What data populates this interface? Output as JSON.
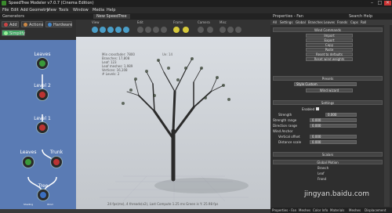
{
  "window": {
    "title": "SpeedTree Modeler v7.0.7 (Cinema Edition)",
    "controls": [
      "–",
      "□",
      "✕"
    ]
  },
  "menu": [
    "File",
    "Edit",
    "Add Geometry",
    "View",
    "Tools",
    "Window",
    "Media",
    "Help"
  ],
  "left_panel": {
    "title": "Generators",
    "buttons": {
      "add": "Add",
      "actions": "Actions",
      "hardware": "Hardware",
      "simplify": "Simplify"
    },
    "nodes": {
      "leaves_top": "Leaves",
      "level2": "Level 2",
      "level1": "Level 1",
      "leaves_left": "Leaves",
      "trunk": "Trunk",
      "tree": "Tree",
      "bottom_left": "Shading",
      "bottom_right": "Wind"
    }
  },
  "viewport": {
    "tab": "New SpeedTree",
    "toolbar_groups": [
      "View",
      "Edit",
      "Frame",
      "Camera",
      "Misc"
    ],
    "stats": [
      "Min crossfader: 7800",
      "Branches: 17,808",
      "Leaf: 123",
      "Leaf meshes: 1,989",
      "Vertices: 16,108",
      "",
      "# Levels: 2"
    ],
    "coord_label": "Ue: 14",
    "footer": "24 fps(ms), 4 threads(x2), Last Compute 1.25 ms Green is Y: 25.98 fps"
  },
  "right_panel": {
    "title": "Properties - Fan",
    "header_tab": "Search Help",
    "tabs": [
      "All",
      "Settings",
      "Global",
      "Branches",
      "Leaves",
      "Fronds",
      "Caps",
      "Roll"
    ],
    "sections": {
      "wind_commands": "Wind Commands",
      "presets": "Presets",
      "settings": "Settings",
      "global_motion": "Global Motion",
      "scalars": "Scalars"
    },
    "buttons": [
      "Import",
      "Export",
      "Copy",
      "Paste",
      "Reset to defaults",
      "Reset wind weights"
    ],
    "preset_label": "Style Custom",
    "wizard_button": "Wind wizard",
    "enabled_label": "Enabled",
    "rows": [
      {
        "label": "Strength",
        "value": "0.000"
      },
      {
        "label": "Strength range",
        "value": "0.000"
      },
      {
        "label": "Direction range",
        "value": "0.000"
      },
      {
        "label": "Wind Anchor",
        "value": ""
      },
      {
        "label": "Vertical offset",
        "value": "0.000"
      },
      {
        "label": "Distance scale",
        "value": "0.000"
      }
    ],
    "global_rows": [
      "Branch",
      "Leaf",
      "Frond"
    ],
    "bottom_tabs": [
      "Properties - Fan",
      "Meshes",
      "Color Info",
      "Materials",
      "Meshes",
      "Displacement"
    ]
  },
  "watermark": "jingyan.baidu.com"
}
